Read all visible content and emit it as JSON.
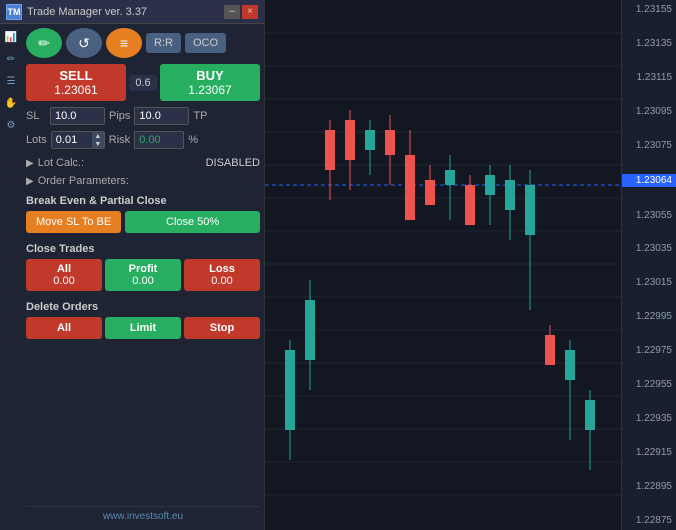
{
  "titleBar": {
    "title": "Trade Manager ver. 3.37",
    "icon": "TM",
    "minimizeBtn": "–",
    "closeBtn": "×"
  },
  "toolbar": {
    "btn1": "✏️",
    "btn2": "↺",
    "btn3": "☰",
    "rr": "R:R",
    "oco": "OCO"
  },
  "buySell": {
    "sellLabel": "SELL",
    "sellPrice": "1.23061",
    "spread": "0.6",
    "buyLabel": "BUY",
    "buyPrice": "1.23067"
  },
  "sltp": {
    "slLabel": "SL",
    "slValue": "10.0",
    "pipsLabel": "Pips",
    "tpValue": "10.0",
    "tpLabel": "TP"
  },
  "lots": {
    "label": "Lots",
    "value": "0.01",
    "riskLabel": "Risk",
    "riskValue": "0.00",
    "pctLabel": "%"
  },
  "lotCalc": {
    "label": "Lot Calc.:",
    "value": "DISABLED"
  },
  "orderParams": {
    "label": "Order Parameters:"
  },
  "breakEven": {
    "header": "Break Even & Partial Close",
    "moveBtn": "Move SL To BE",
    "closeBtn": "Close 50%"
  },
  "closeTrades": {
    "header": "Close Trades",
    "all": {
      "label": "All",
      "value": "0.00"
    },
    "profit": {
      "label": "Profit",
      "value": "0.00"
    },
    "loss": {
      "label": "Loss",
      "value": "0.00"
    }
  },
  "deleteOrders": {
    "header": "Delete Orders",
    "all": "All",
    "limit": "Limit",
    "stop": "Stop"
  },
  "footer": {
    "url": "www.investsoft.eu"
  },
  "priceScale": {
    "prices": [
      "1.23155",
      "1.23135",
      "1.23115",
      "1.23095",
      "1.23075",
      "1.23064",
      "1.23055",
      "1.23035",
      "1.23015",
      "1.22995",
      "1.22975",
      "1.22955",
      "1.22935",
      "1.22915",
      "1.22895",
      "1.22875"
    ],
    "highlightPrice": "1.23064"
  },
  "sidebarIcons": [
    "📊",
    "✏️",
    "☰",
    "🖐",
    "⚙"
  ]
}
